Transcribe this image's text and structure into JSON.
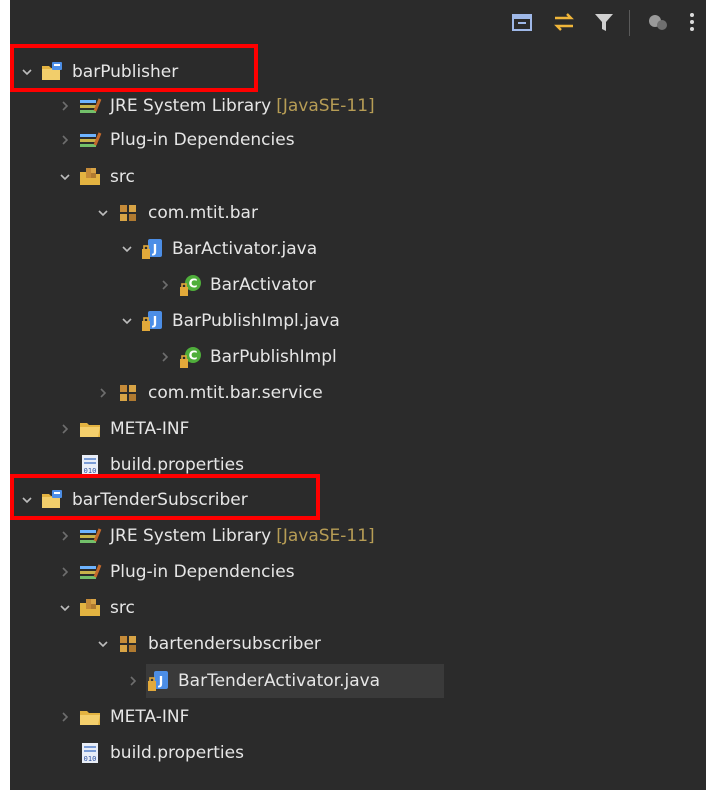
{
  "colors": {
    "panel_bg": "#2b2b2b",
    "text": "#e6e6e6",
    "decoration": "#b79d55",
    "highlight_box": "#ff0000",
    "selected_row": "#3a3a3a"
  },
  "toolbar": {
    "collapse_all_icon": "collapse-all-icon",
    "link_with_editor_icon": "link-with-editor-icon",
    "filter_icon": "filter-icon",
    "focus_icon": "focus-on-active-task-icon",
    "menu_icon": "view-menu-icon"
  },
  "tree": {
    "projects": [
      {
        "name": "barPublisher",
        "children": {
          "jre": {
            "label": "JRE System Library",
            "decoration": "[JavaSE-11]"
          },
          "plugin_deps": {
            "label": "Plug-in Dependencies"
          },
          "src": {
            "label": "src",
            "packages": [
              {
                "label": "com.mtit.bar",
                "files": [
                  {
                    "label": "BarActivator.java",
                    "type_label": "BarActivator"
                  },
                  {
                    "label": "BarPublishImpl.java",
                    "type_label": "BarPublishImpl"
                  }
                ]
              },
              {
                "label": "com.mtit.bar.service"
              }
            ]
          },
          "meta_inf": {
            "label": "META-INF"
          },
          "build_properties": {
            "label": "build.properties"
          }
        }
      },
      {
        "name": "barTenderSubscriber",
        "children": {
          "jre": {
            "label": "JRE System Library",
            "decoration": "[JavaSE-11]"
          },
          "plugin_deps": {
            "label": "Plug-in Dependencies"
          },
          "src": {
            "label": "src",
            "packages": [
              {
                "label": "bartendersubscriber",
                "files": [
                  {
                    "label": "BarTenderActivator.java"
                  }
                ]
              }
            ]
          },
          "meta_inf": {
            "label": "META-INF"
          },
          "build_properties": {
            "label": "build.properties"
          }
        }
      }
    ]
  }
}
